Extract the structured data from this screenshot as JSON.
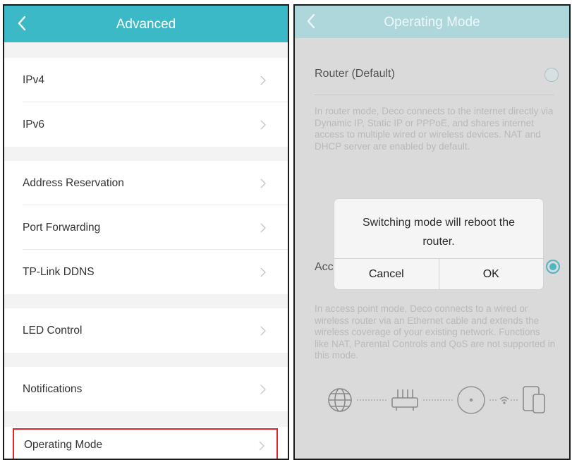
{
  "left": {
    "title": "Advanced",
    "items": [
      {
        "label": "IPv4"
      },
      {
        "label": "IPv6"
      },
      {
        "label": "Address Reservation"
      },
      {
        "label": "Port Forwarding"
      },
      {
        "label": "TP-Link DDNS"
      },
      {
        "label": "LED Control"
      },
      {
        "label": "Notifications"
      },
      {
        "label": "Operating Mode"
      }
    ],
    "icons": {
      "back": "chevron-left-icon",
      "row": "chevron-right-icon"
    },
    "colors": {
      "appbar": "#3cb9c7",
      "highlight": "#e0252c"
    }
  },
  "right": {
    "title": "Operating Mode",
    "router": {
      "title": "Router (Default)",
      "description": "In router mode, Deco connects to the internet directly via Dynamic IP, Static IP or PPPoE, and shares internet access to multiple wired or wireless devices. NAT and DHCP server are enabled by default."
    },
    "access_point": {
      "title_visible": "Acc",
      "description": "In access point mode, Deco connects to a wired or wireless router via an Ethernet cable and extends the wireless coverage of your existing network. Functions like NAT, Parental Controls and QoS are not supported in this mode."
    },
    "dialog": {
      "message": "Switching mode will reboot the router.",
      "cancel": "Cancel",
      "ok": "OK"
    },
    "icons": [
      "globe-icon",
      "router-icon",
      "deco-icon",
      "wifi-icon",
      "devices-icon"
    ],
    "colors": {
      "appbar": "#aed7dc",
      "accent": "#35b3c1"
    }
  }
}
